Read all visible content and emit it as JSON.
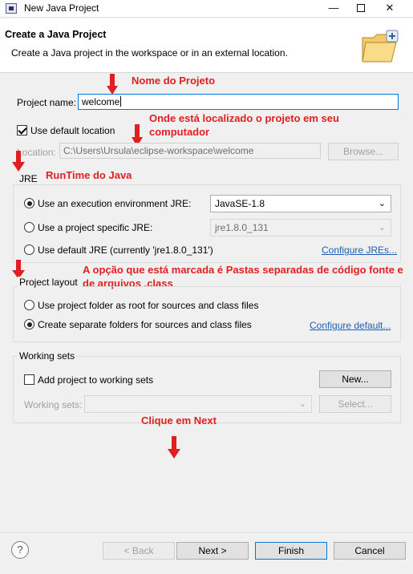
{
  "window": {
    "title": "New Java Project",
    "minimize_label": "—",
    "close_label": "✕"
  },
  "banner": {
    "title": "Create a Java Project",
    "description": "Create a Java project in the workspace or in an external location."
  },
  "annotations": {
    "project_name": "Nome do Projeto",
    "location": "Onde está localizado o projeto em seu computador",
    "jre": "RunTime do Java",
    "layout": "A opção que está marcada é Pastas separadas de código fonte e de arquivos .class",
    "next": "Clique em Next",
    "color": "#e02020"
  },
  "project": {
    "name_label": "Project name:",
    "name_value": "welcome"
  },
  "location": {
    "use_default_label": "Use default location",
    "use_default_checked": true,
    "location_label": "Location:",
    "location_value": "C:\\Users\\Ursula\\eclipse-workspace\\welcome",
    "browse_label": "Browse..."
  },
  "jre": {
    "group_title": "JRE",
    "option_env_label": "Use an execution environment JRE:",
    "option_env_value": "JavaSE-1.8",
    "option_specific_label": "Use a project specific JRE:",
    "option_specific_value": "jre1.8.0_131",
    "option_default_label": "Use default JRE (currently 'jre1.8.0_131')",
    "configure_link": "Configure JREs...",
    "selected": "env"
  },
  "layout": {
    "group_title": "Project layout",
    "option_root_label": "Use project folder as root for sources and class files",
    "option_separate_label": "Create separate folders for sources and class files",
    "configure_link": "Configure default...",
    "selected": "separate"
  },
  "working_sets": {
    "group_title": "Working sets",
    "add_label": "Add project to working sets",
    "add_checked": false,
    "new_button": "New...",
    "sets_label": "Working sets:",
    "sets_value": "",
    "select_button": "Select..."
  },
  "footer": {
    "help_label": "?",
    "back_button": "< Back",
    "next_button": "Next >",
    "finish_button": "Finish",
    "cancel_button": "Cancel"
  },
  "icons": [
    "java-app-icon",
    "new-project-folder-icon",
    "annotation-arrow-icon",
    "chevron-down-icon",
    "help-icon"
  ]
}
